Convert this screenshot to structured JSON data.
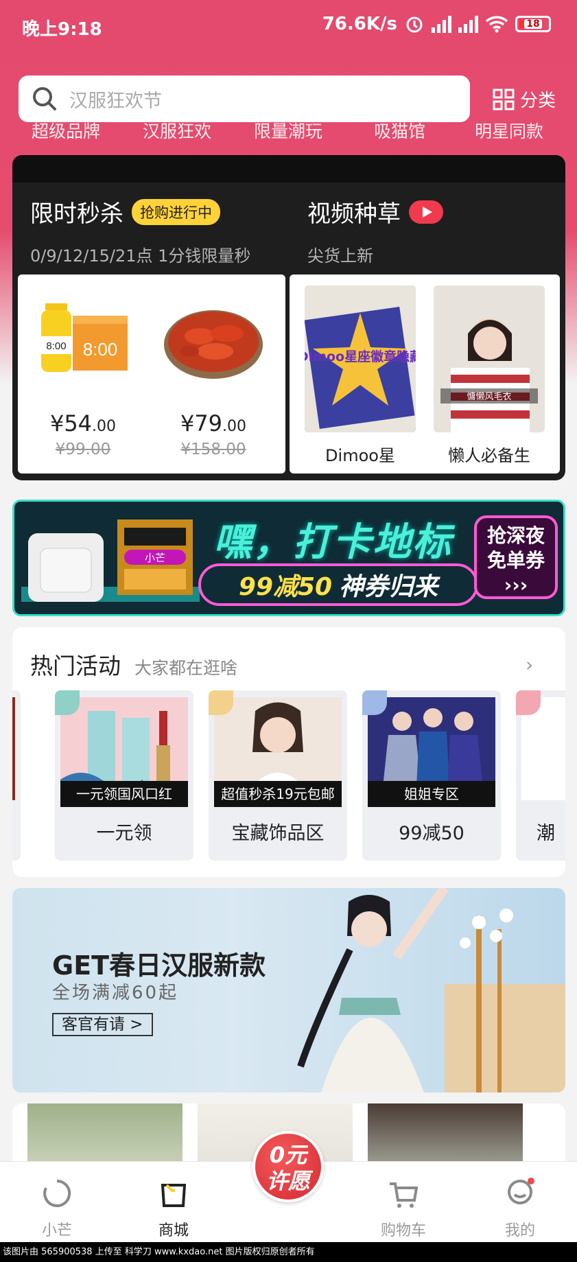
{
  "status_bar": {
    "time": "晚上9:18",
    "network_speed": "76.6K/s",
    "battery": "18"
  },
  "search": {
    "placeholder": "汉服狂欢节",
    "category_label": "分类"
  },
  "nav_items": [
    "超级品牌",
    "汉服狂欢",
    "限量潮玩",
    "吸猫馆",
    "明星同款"
  ],
  "flash_sale": {
    "title": "限时秒杀",
    "badge": "抢购进行中",
    "subtitle": "0/9/12/15/21点 1分钱限量秒",
    "products": [
      {
        "price_main": "¥54",
        "price_dec": ".00",
        "old_price": "¥99.00"
      },
      {
        "price_main": "¥79",
        "price_dec": ".00",
        "old_price": "¥158.00"
      }
    ],
    "product_art": {
      "box_text": "8:00",
      "bottle_label": "8:00"
    }
  },
  "video": {
    "title": "视频种草",
    "subtitle": "尖货上新",
    "items": [
      {
        "caption": "Dimoo星",
        "overlay": "Dimoo星座徽章隐藏"
      },
      {
        "caption": "懒人必备生",
        "overlay": "慵懒风毛衣"
      }
    ]
  },
  "promo_banner": {
    "headline": "嘿，打卡地标",
    "deal_highlight": "99减50",
    "deal_text": "神券归来",
    "cta_line1": "抢深夜",
    "cta_line2": "免单券",
    "badge": "小芒"
  },
  "hot_activities": {
    "title": "热门活动",
    "subtitle": "大家都在逛啥",
    "cards": [
      {
        "strip": "一元领国风口红",
        "label": "一元领"
      },
      {
        "strip": "超值秒杀19元包邮",
        "label": "宝藏饰品区"
      },
      {
        "strip": "姐姐专区",
        "label": "99减50"
      },
      {
        "strip": "",
        "label": "潮"
      }
    ]
  },
  "hanfu_banner": {
    "title": "GET春日汉服新款",
    "subtitle": "全场满减60起",
    "button": "客官有请 >"
  },
  "tab_bar": {
    "tabs": [
      {
        "label": "小芒"
      },
      {
        "label": "商城"
      },
      {
        "label": "购物车"
      },
      {
        "label": "我的"
      }
    ],
    "wish_line1": "0元",
    "wish_line2": "许愿"
  },
  "footer": "该图片由 565900538 上传至 科学刀 www.kxdao.net 图片版权归原创者所有",
  "colors": {
    "brand": "#e34a6d",
    "badge_yellow": "#ffd23a",
    "neon": "#4cf0d6"
  }
}
